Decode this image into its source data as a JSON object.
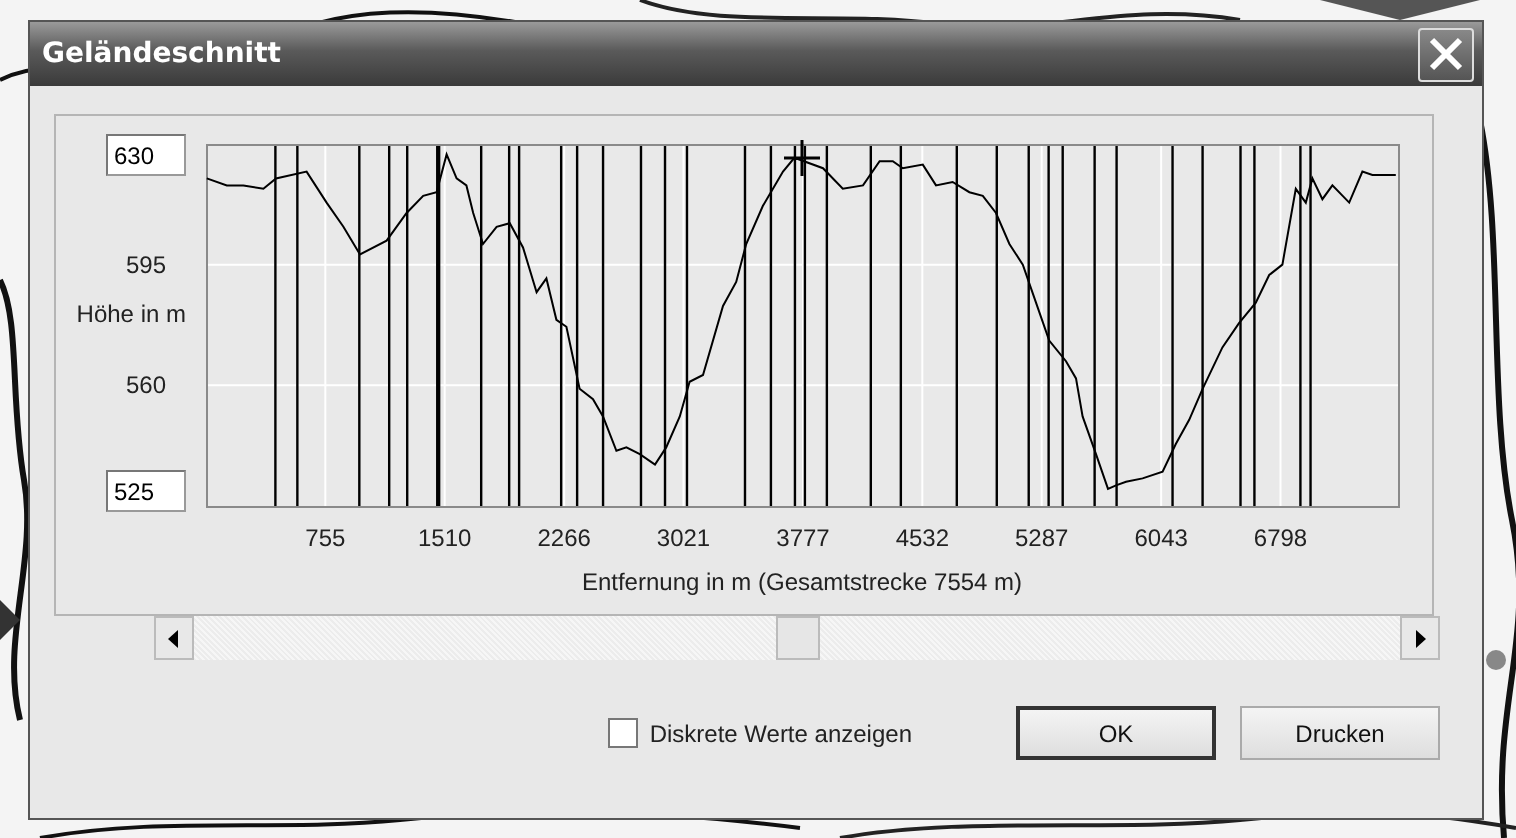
{
  "window": {
    "title": "Geländeschnitt"
  },
  "axis_fields": {
    "max": "630",
    "min": "525"
  },
  "chart_data": {
    "type": "line",
    "xlabel": "Entfernung in m (Gesamtstrecke 7554 m)",
    "ylabel": "Höhe in m",
    "x": [
      5,
      131,
      236,
      363,
      443,
      637,
      763,
      869,
      974,
      1143,
      1269,
      1374,
      1459,
      1522,
      1585,
      1648,
      1690,
      1753,
      1838,
      1922,
      2006,
      2091,
      2154,
      2217,
      2280,
      2364,
      2449,
      2512,
      2596,
      2660,
      2744,
      2841,
      2912,
      2997,
      3060,
      3144,
      3271,
      3355,
      3418,
      3523,
      3650,
      3722,
      3903,
      4029,
      4156,
      4261,
      4345,
      4408,
      4535,
      4619,
      4724,
      4830,
      4914,
      4998,
      5083,
      5167,
      5251,
      5335,
      5441,
      5504,
      5546,
      5631,
      5706,
      5757,
      5820,
      5925,
      6052,
      6136,
      6220,
      6305,
      6431,
      6536,
      6642,
      6726,
      6810,
      6895,
      6958,
      7000,
      7063,
      7126,
      7232,
      7316,
      7379,
      7527
    ],
    "series": [
      {
        "color": "#000000",
        "values": [
          620,
          618,
          618,
          617,
          620,
          622,
          613,
          606,
          598,
          602,
          610,
          615,
          616,
          627,
          620,
          618,
          610,
          601,
          606,
          607,
          600,
          587,
          591,
          579,
          577,
          559,
          556,
          551,
          541,
          542,
          540,
          537,
          542,
          551,
          561,
          563,
          583,
          590,
          601,
          612,
          622,
          626,
          623,
          617,
          618,
          625,
          625,
          623,
          624,
          618,
          619,
          616,
          615,
          610,
          601,
          595,
          584,
          573,
          567,
          562,
          551,
          540,
          530,
          531,
          532,
          533,
          535,
          543,
          550,
          559,
          571,
          578,
          584,
          592,
          595,
          617,
          613,
          620,
          614,
          618,
          613,
          622,
          621,
          621
        ]
      }
    ],
    "xlim": [
      0,
      7554
    ],
    "ylim": [
      525,
      630
    ],
    "xticks": [
      755,
      1510,
      2266,
      3021,
      3777,
      4532,
      5287,
      6043,
      6798
    ],
    "yticks": [
      560,
      595
    ],
    "grid": true,
    "ref_lines": [
      {
        "axis": "x",
        "value": 439
      },
      {
        "axis": "x",
        "value": 578
      },
      {
        "axis": "x",
        "value": 970
      },
      {
        "axis": "x",
        "value": 1159
      },
      {
        "axis": "x",
        "value": 1273
      },
      {
        "axis": "x",
        "value": 1463
      },
      {
        "axis": "x",
        "value": 1475
      },
      {
        "axis": "x",
        "value": 1741
      },
      {
        "axis": "x",
        "value": 1918
      },
      {
        "axis": "x",
        "value": 1981
      },
      {
        "axis": "x",
        "value": 2247
      },
      {
        "axis": "x",
        "value": 2348
      },
      {
        "axis": "x",
        "value": 2512
      },
      {
        "axis": "x",
        "value": 2752
      },
      {
        "axis": "x",
        "value": 2904
      },
      {
        "axis": "x",
        "value": 3043
      },
      {
        "axis": "x",
        "value": 3410
      },
      {
        "axis": "x",
        "value": 3574
      },
      {
        "axis": "x",
        "value": 3726
      },
      {
        "axis": "x",
        "value": 3789
      },
      {
        "axis": "x",
        "value": 3928
      },
      {
        "axis": "x",
        "value": 4206
      },
      {
        "axis": "x",
        "value": 4396
      },
      {
        "axis": "x",
        "value": 4750
      },
      {
        "axis": "x",
        "value": 5003
      },
      {
        "axis": "x",
        "value": 5205
      },
      {
        "axis": "x",
        "value": 5331
      },
      {
        "axis": "x",
        "value": 5420
      },
      {
        "axis": "x",
        "value": 5622
      },
      {
        "axis": "x",
        "value": 5761
      },
      {
        "axis": "x",
        "value": 6115
      },
      {
        "axis": "x",
        "value": 6305
      },
      {
        "axis": "x",
        "value": 6545
      },
      {
        "axis": "x",
        "value": 6633
      },
      {
        "axis": "x",
        "value": 6924
      },
      {
        "axis": "x",
        "value": 6988
      }
    ]
  },
  "checkbox": {
    "label": "Diskrete Werte anzeigen",
    "checked": false
  },
  "buttons": [
    {
      "label": "OK",
      "default": true
    },
    {
      "label": "Drucken",
      "default": false
    }
  ]
}
